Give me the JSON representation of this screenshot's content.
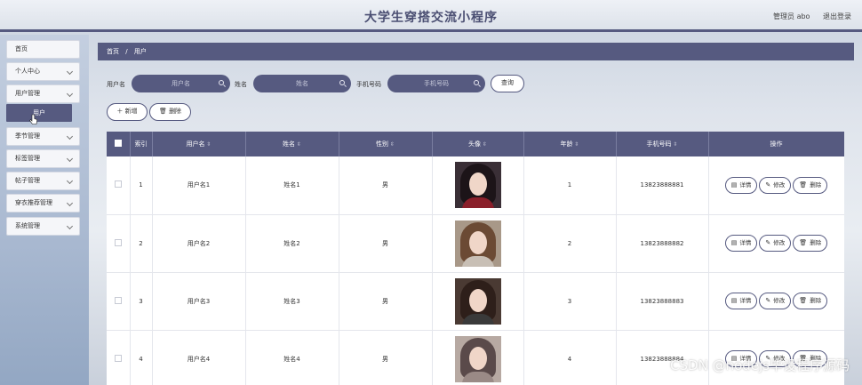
{
  "header": {
    "title": "大学生穿搭交流小程序",
    "user": "管理员 abo",
    "logout": "退出登录"
  },
  "sidebar": {
    "items": [
      {
        "label": "首页"
      },
      {
        "label": "个人中心"
      },
      {
        "label": "用户管理"
      },
      {
        "label": "季节管理"
      },
      {
        "label": "标签管理"
      },
      {
        "label": "帖子管理"
      },
      {
        "label": "穿衣推荐管理"
      },
      {
        "label": "系统管理"
      }
    ],
    "active_sub": "用户"
  },
  "breadcrumb": {
    "home": "首页",
    "sep": "/",
    "current": "用户"
  },
  "search": {
    "username_label": "用户名",
    "username_placeholder": "用户名",
    "name_label": "姓名",
    "name_placeholder": "姓名",
    "phone_label": "手机号码",
    "phone_placeholder": "手机号码",
    "query": "查询"
  },
  "toolbar": {
    "add": "新增",
    "delete": "删除"
  },
  "table": {
    "headers": {
      "index": "索引",
      "username": "用户名",
      "name": "姓名",
      "gender": "性别",
      "avatar": "头像",
      "age": "年龄",
      "phone": "手机号码",
      "actions": "操作"
    },
    "rows": [
      {
        "index": "1",
        "username": "用户名1",
        "name": "姓名1",
        "gender": "男",
        "age": "1",
        "phone": "13823888881"
      },
      {
        "index": "2",
        "username": "用户名2",
        "name": "姓名2",
        "gender": "男",
        "age": "2",
        "phone": "13823888882"
      },
      {
        "index": "3",
        "username": "用户名3",
        "name": "姓名3",
        "gender": "男",
        "age": "3",
        "phone": "13823888883"
      },
      {
        "index": "4",
        "username": "用户名4",
        "name": "姓名4",
        "gender": "男",
        "age": "4",
        "phone": "13823888884"
      }
    ],
    "actions": {
      "detail": "详情",
      "edit": "修改",
      "delete": "删除"
    }
  },
  "watermark": "CSDN @nodejs毕设程序源码",
  "colors": {
    "accent": "#565a80"
  }
}
